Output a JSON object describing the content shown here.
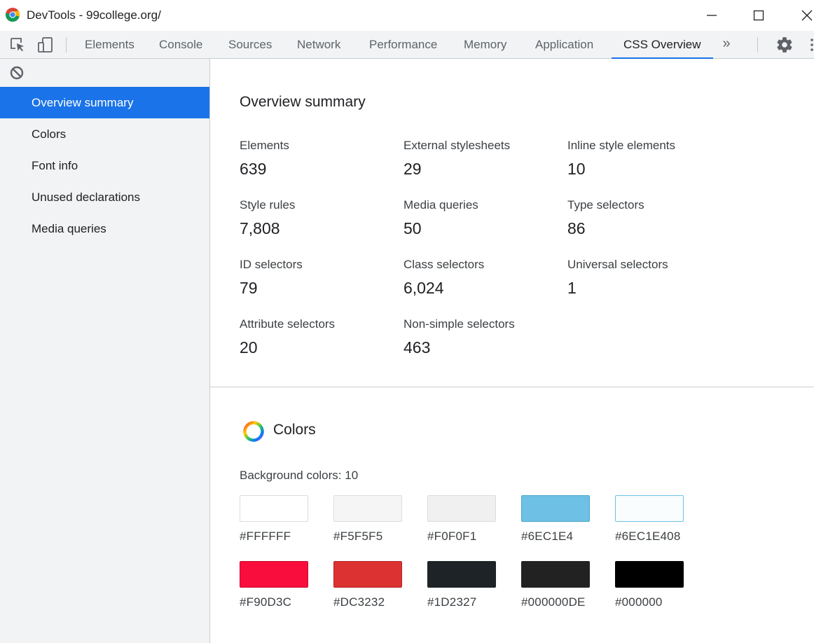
{
  "window": {
    "title": "DevTools - 99college.org/"
  },
  "toolbar": {
    "inspect_icon": "element-picker-icon",
    "device_icon": "device-toolbar-icon",
    "tabs": [
      {
        "label": "Elements",
        "active": false
      },
      {
        "label": "Console",
        "active": false
      },
      {
        "label": "Sources",
        "active": false
      },
      {
        "label": "Network",
        "active": false
      },
      {
        "label": "Performance",
        "active": false
      },
      {
        "label": "Memory",
        "active": false
      },
      {
        "label": "Application",
        "active": false
      },
      {
        "label": "CSS Overview",
        "active": true
      }
    ],
    "more_tabs": "»",
    "settings_icon": "gear-icon",
    "menu_icon": "kebab-menu-icon"
  },
  "sidebar": {
    "clear_icon": "block-icon",
    "items": [
      {
        "label": "Overview summary",
        "active": true
      },
      {
        "label": "Colors",
        "active": false
      },
      {
        "label": "Font info",
        "active": false
      },
      {
        "label": "Unused declarations",
        "active": false
      },
      {
        "label": "Media queries",
        "active": false
      }
    ]
  },
  "overview": {
    "title": "Overview summary",
    "stats": [
      {
        "label": "Elements",
        "value": "639"
      },
      {
        "label": "External stylesheets",
        "value": "29"
      },
      {
        "label": "Inline style elements",
        "value": "10"
      },
      {
        "label": "Style rules",
        "value": "7,808"
      },
      {
        "label": "Media queries",
        "value": "50"
      },
      {
        "label": "Type selectors",
        "value": "86"
      },
      {
        "label": "ID selectors",
        "value": "79"
      },
      {
        "label": "Class selectors",
        "value": "6,024"
      },
      {
        "label": "Universal selectors",
        "value": "1"
      },
      {
        "label": "Attribute selectors",
        "value": "20"
      },
      {
        "label": "Non-simple selectors",
        "value": "463"
      }
    ]
  },
  "colors": {
    "title": "Colors",
    "icon": "color-wheel-icon",
    "background_label": "Background colors: 10",
    "background": [
      {
        "hex": "#FFFFFF",
        "fill": "#ffffff",
        "border": "#dadce0"
      },
      {
        "hex": "#F5F5F5",
        "fill": "#f5f5f5",
        "border": "#dadce0"
      },
      {
        "hex": "#F0F0F1",
        "fill": "#f0f0f1",
        "border": "#dadce0"
      },
      {
        "hex": "#6EC1E4",
        "fill": "#6ec1e4",
        "border": "#4aa6cc"
      },
      {
        "hex": "#6EC1E408",
        "fill": "#f9fdfe",
        "border": "#6ec1e4"
      },
      {
        "hex": "#F90D3C",
        "fill": "#f90d3c",
        "border": "#c90a30"
      },
      {
        "hex": "#DC3232",
        "fill": "#dc3232",
        "border": "#b32828"
      },
      {
        "hex": "#1D2327",
        "fill": "#1d2327",
        "border": "#1d2327"
      },
      {
        "hex": "#000000DE",
        "fill": "#222222",
        "border": "#222222"
      },
      {
        "hex": "#000000",
        "fill": "#000000",
        "border": "#000000"
      }
    ]
  }
}
